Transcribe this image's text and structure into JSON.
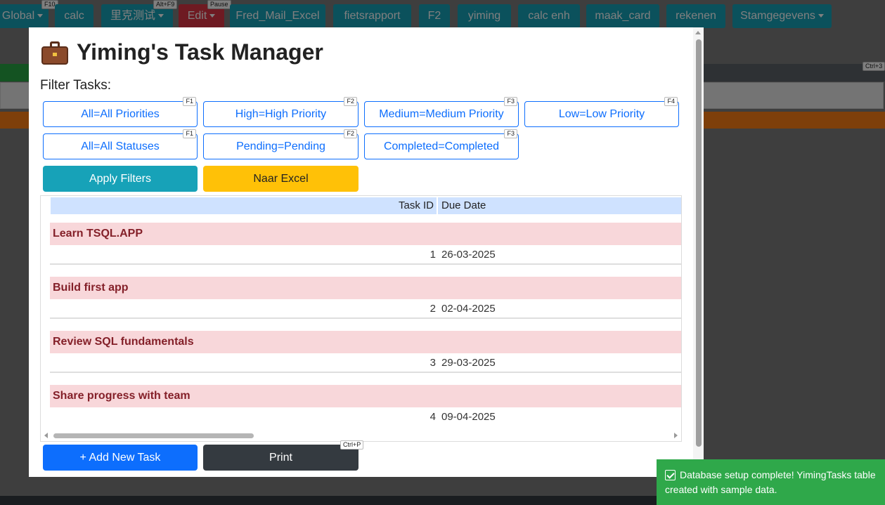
{
  "toolbar": {
    "items": [
      {
        "label": "Global",
        "shortcut": "F10",
        "dropdown": true
      },
      {
        "label": "calc"
      },
      {
        "label": "里克测试",
        "shortcut": "Alt+F9",
        "dropdown": true
      },
      {
        "label": "Edit",
        "shortcut": "Pause",
        "dropdown": true
      },
      {
        "label": "Fred_Mail_Excel"
      },
      {
        "label": "fietsrapport"
      },
      {
        "label": "F2"
      },
      {
        "label": "yiming"
      },
      {
        "label": "calc enh"
      },
      {
        "label": "maak_card"
      },
      {
        "label": "rekenen"
      },
      {
        "label": "Stamgegevens",
        "dropdown": true
      }
    ],
    "ctrl3_badge": "Ctrl+3"
  },
  "modal": {
    "title": "Yiming's Task Manager",
    "title_icon": "briefcase-icon",
    "filter_label": "Filter Tasks:",
    "priority_filters": [
      {
        "label": "All=All Priorities",
        "shortcut": "F1"
      },
      {
        "label": "High=High Priority",
        "shortcut": "F2"
      },
      {
        "label": "Medium=Medium Priority",
        "shortcut": "F3"
      },
      {
        "label": "Low=Low Priority",
        "shortcut": "F4"
      }
    ],
    "status_filters": [
      {
        "label": "All=All Statuses",
        "shortcut": "F1"
      },
      {
        "label": "Pending=Pending",
        "shortcut": "F2"
      },
      {
        "label": "Completed=Completed",
        "shortcut": "F3"
      }
    ],
    "apply_button": "Apply Filters",
    "excel_button": "Naar Excel",
    "grid": {
      "columns": [
        "Task ID",
        "Due Date"
      ],
      "groups": [
        {
          "title": "Learn TSQL.APP",
          "task_id": "1",
          "due_date": "26-03-2025"
        },
        {
          "title": "Build first app",
          "task_id": "2",
          "due_date": "02-04-2025"
        },
        {
          "title": "Review SQL fundamentals",
          "task_id": "3",
          "due_date": "29-03-2025"
        },
        {
          "title": "Share progress with team",
          "task_id": "4",
          "due_date": "09-04-2025"
        }
      ]
    },
    "add_button": "+ Add New Task",
    "print_button": "Print",
    "print_shortcut": "Ctrl+P"
  },
  "toast": {
    "message": "Database setup complete! YimingTasks table created with sample data."
  },
  "colors": {
    "primary": "#0d6efd",
    "info": "#17a2b8",
    "warning": "#ffc107",
    "dark": "#343a40",
    "danger_bg": "#f8d7da",
    "success": "#2fa84a"
  }
}
